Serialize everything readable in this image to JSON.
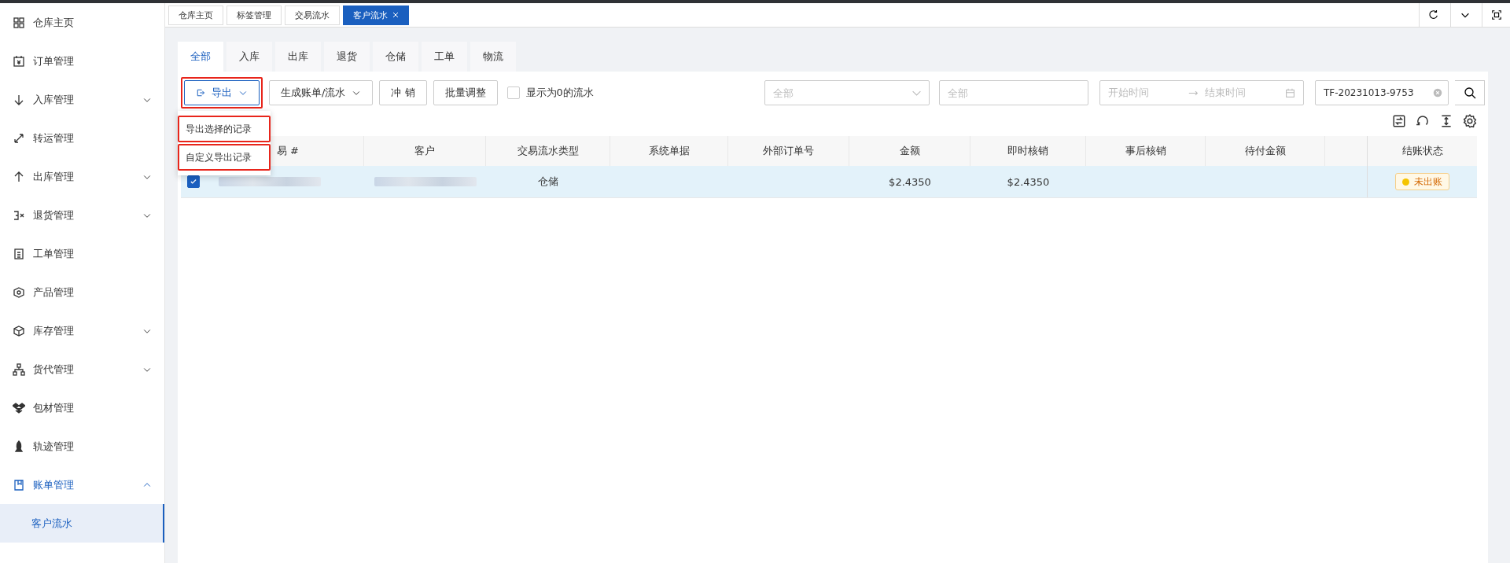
{
  "sidebar": {
    "items": [
      {
        "label": "仓库主页",
        "selected": false
      },
      {
        "label": "订单管理",
        "selected": false
      },
      {
        "label": "入库管理",
        "selected": false,
        "expanded": false
      },
      {
        "label": "转运管理",
        "selected": false
      },
      {
        "label": "出库管理",
        "selected": false,
        "expanded": false
      },
      {
        "label": "退货管理",
        "selected": false,
        "expanded": false
      },
      {
        "label": "工单管理",
        "selected": false
      },
      {
        "label": "产品管理",
        "selected": false
      },
      {
        "label": "库存管理",
        "selected": false,
        "expanded": false
      },
      {
        "label": "货代管理",
        "selected": false,
        "expanded": false
      },
      {
        "label": "包材管理",
        "selected": false
      },
      {
        "label": "轨迹管理",
        "selected": false
      },
      {
        "label": "账单管理",
        "selected": false,
        "expanded": true,
        "children": [
          {
            "label": "客户流水",
            "selected": true
          }
        ]
      }
    ]
  },
  "page_tabs": [
    {
      "label": "仓库主页",
      "selected": false,
      "closable": false
    },
    {
      "label": "标签管理",
      "selected": false,
      "closable": false
    },
    {
      "label": "交易流水",
      "selected": false,
      "closable": false
    },
    {
      "label": "客户流水",
      "selected": true,
      "closable": true
    }
  ],
  "category_tabs": [
    {
      "label": "全部",
      "selected": true
    },
    {
      "label": "入库",
      "selected": false
    },
    {
      "label": "出库",
      "selected": false
    },
    {
      "label": "退货",
      "selected": false
    },
    {
      "label": "仓储",
      "selected": false
    },
    {
      "label": "工单",
      "selected": false
    },
    {
      "label": "物流",
      "selected": false
    }
  ],
  "toolbar": {
    "export_button": {
      "label": "导出",
      "expanded": true,
      "highlighted": true
    },
    "buttons": [
      {
        "label": "生成账单/流水",
        "kind": "dropdown"
      },
      {
        "label": "冲 销",
        "kind": "plain"
      },
      {
        "label": "批量调整",
        "kind": "plain"
      }
    ],
    "zero_checkbox": {
      "label": "显示为0的流水",
      "checked": false
    }
  },
  "filters": {
    "type_select": {
      "placeholder": "全部"
    },
    "customer_field": {
      "placeholder": "全部"
    },
    "date_range": {
      "start_placeholder": "开始时间",
      "end_placeholder": "结束时间"
    },
    "search_field": {
      "value": "TF-20231013-9753"
    }
  },
  "export_menu": {
    "items": [
      {
        "label": "导出选择的记录",
        "highlighted": true
      },
      {
        "label": "自定义导出记录",
        "highlighted": true
      }
    ]
  },
  "table": {
    "columns": [
      {
        "label": "易 #"
      },
      {
        "label": "客户"
      },
      {
        "label": "交易流水类型"
      },
      {
        "label": "系统单据"
      },
      {
        "label": "外部订单号"
      },
      {
        "label": "金额"
      },
      {
        "label": "即时核销"
      },
      {
        "label": "事后核销"
      },
      {
        "label": "待付金额"
      },
      {
        "kind": "cut"
      },
      {
        "label": "结账状态"
      }
    ],
    "rows": [
      {
        "selected": true,
        "cells": [
          {
            "kind": "redacted"
          },
          {
            "kind": "redacted"
          },
          {
            "kind": "text",
            "text": "仓储"
          },
          {
            "kind": "empty"
          },
          {
            "kind": "empty"
          },
          {
            "kind": "text",
            "text": "$2.4350"
          },
          {
            "kind": "text",
            "text": "$2.4350"
          },
          {
            "kind": "empty"
          },
          {
            "kind": "empty"
          },
          {
            "kind": "empty"
          },
          {
            "kind": "status",
            "text": "未出账",
            "color": "#f5c400"
          }
        ]
      }
    ]
  }
}
